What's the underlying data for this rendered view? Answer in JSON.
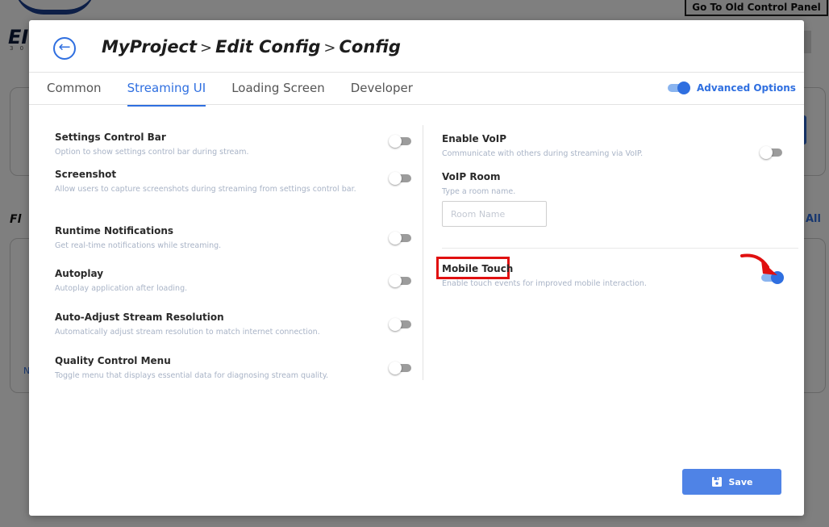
{
  "background": {
    "logo_letters": "EI",
    "logo_sub": "3 0",
    "old_panel_button": "Go To Old Control Panel",
    "side_f": "Fl",
    "side_all": "All",
    "side_n": "N"
  },
  "header": {
    "crumbs": [
      "MyProject",
      "Edit Config",
      "Config"
    ],
    "separator": ">"
  },
  "tabs": [
    {
      "label": "Common",
      "active": false
    },
    {
      "label": "Streaming UI",
      "active": true
    },
    {
      "label": "Loading Screen",
      "active": false
    },
    {
      "label": "Developer",
      "active": false
    }
  ],
  "advanced": {
    "label": "Advanced Options",
    "on": true
  },
  "left_settings": [
    {
      "title": "Settings Control Bar",
      "desc": "Option to show settings control bar during stream.",
      "on": false
    },
    {
      "title": "Screenshot",
      "desc": "Allow users to capture screenshots during streaming from settings control bar.",
      "on": false
    },
    {
      "title": "Runtime Notifications",
      "desc": "Get real-time notifications while streaming.",
      "on": false
    },
    {
      "title": "Autoplay",
      "desc": "Autoplay application after loading.",
      "on": false
    },
    {
      "title": "Auto-Adjust Stream Resolution",
      "desc": "Automatically adjust stream resolution to match internet connection.",
      "on": false
    },
    {
      "title": "Quality Control Menu",
      "desc": "Toggle menu that displays essential data for diagnosing stream quality.",
      "on": false
    }
  ],
  "voip": {
    "title": "Enable VoIP",
    "desc": "Communicate with others during streaming via VoIP.",
    "on": false
  },
  "voip_room": {
    "title": "VoIP Room",
    "desc": "Type a room name.",
    "placeholder": "Room Name",
    "value": ""
  },
  "mobile_touch": {
    "title": "Mobile Touch",
    "desc": "Enable touch events for improved mobile interaction.",
    "on": true
  },
  "save": {
    "label": "Save"
  },
  "colors": {
    "accent": "#2f6fe0",
    "highlight": "#e01010"
  }
}
